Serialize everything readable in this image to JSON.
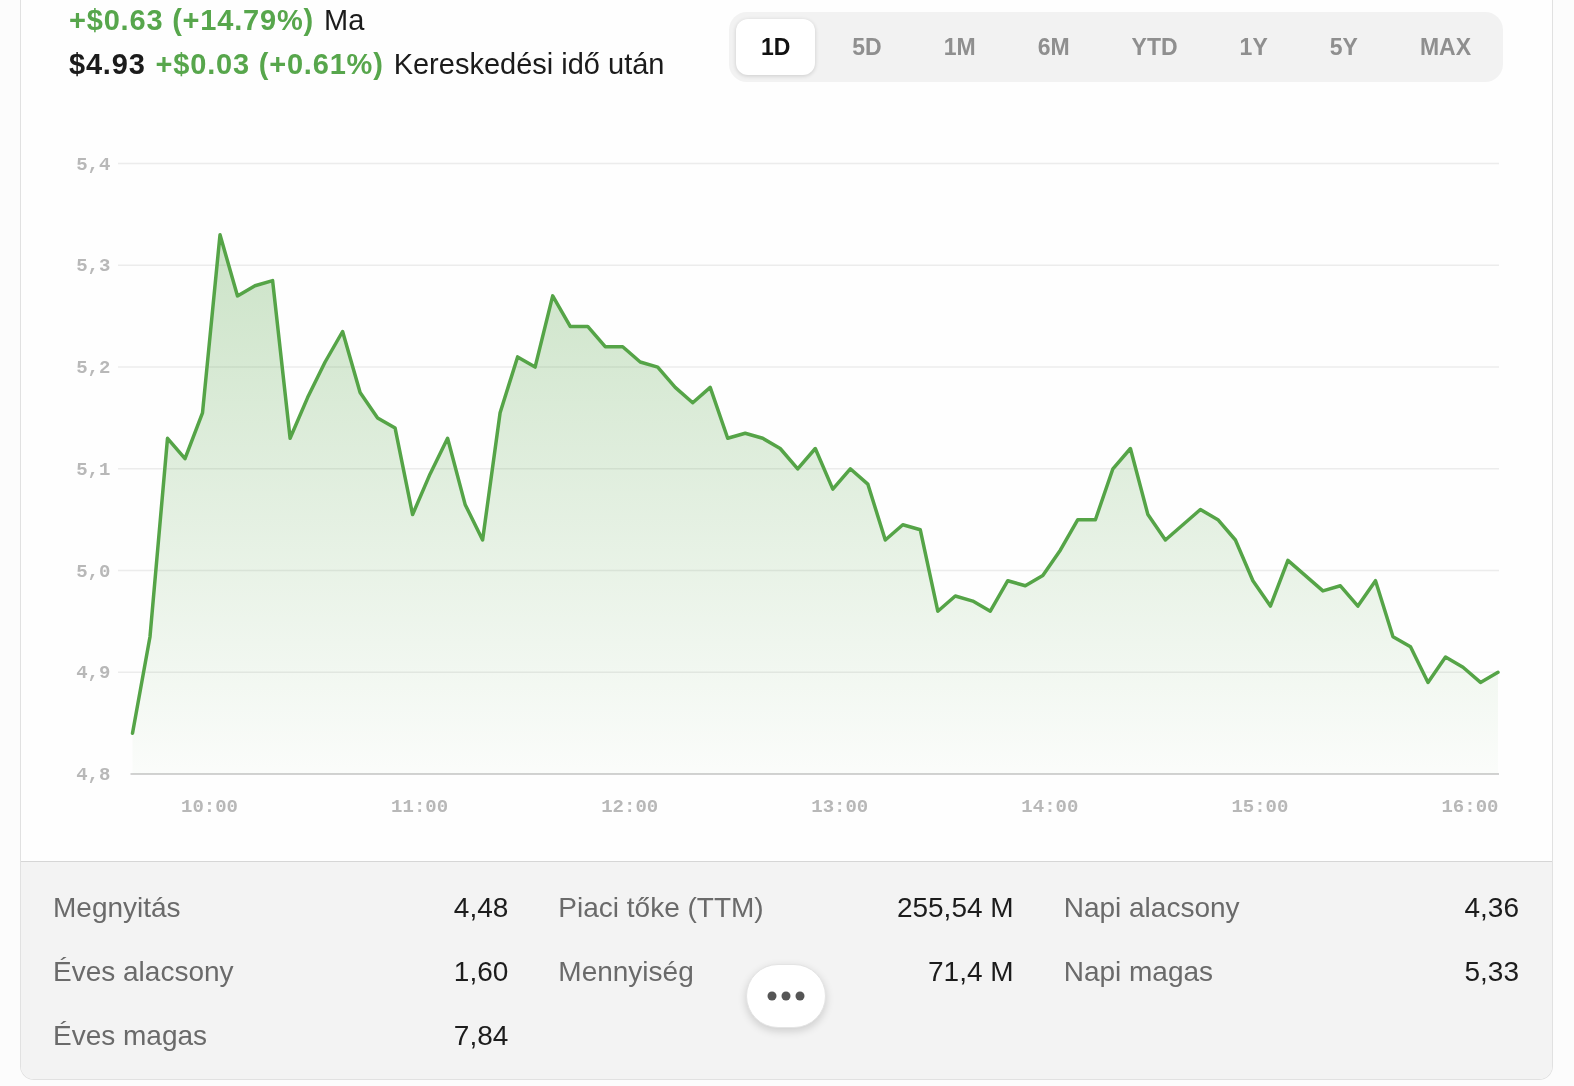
{
  "quote": {
    "today": {
      "change": "+$0.63 (+14.79%)",
      "label": "Ma"
    },
    "after_hours": {
      "price": "$4.93",
      "change": "+$0.03 (+0.61%)",
      "label": "Kereskedési idő után"
    }
  },
  "range_tabs": [
    {
      "label": "1D",
      "selected": true
    },
    {
      "label": "5D",
      "selected": false
    },
    {
      "label": "1M",
      "selected": false
    },
    {
      "label": "6M",
      "selected": false
    },
    {
      "label": "YTD",
      "selected": false
    },
    {
      "label": "1Y",
      "selected": false
    },
    {
      "label": "5Y",
      "selected": false
    },
    {
      "label": "MAX",
      "selected": false
    }
  ],
  "chart": {
    "chart_data": {
      "type": "area",
      "grid": true,
      "x": [
        578,
        583,
        588,
        593,
        598,
        603,
        608,
        613,
        618,
        623,
        628,
        633,
        638,
        643,
        648,
        653,
        658,
        663,
        668,
        673,
        678,
        683,
        688,
        693,
        698,
        703,
        708,
        713,
        718,
        723,
        728,
        733,
        738,
        743,
        748,
        753,
        758,
        763,
        768,
        773,
        778,
        783,
        788,
        793,
        798,
        803,
        808,
        813,
        818,
        823,
        828,
        833,
        838,
        843,
        848,
        853,
        858,
        863,
        868,
        873,
        878,
        883,
        888,
        893,
        898,
        903,
        908,
        913,
        918,
        923,
        928,
        933,
        938,
        943,
        948,
        953,
        958,
        963,
        968
      ],
      "series": [
        {
          "color": "#55a447",
          "values": [
            4.84,
            4.935,
            5.13,
            5.11,
            5.155,
            5.33,
            5.27,
            5.28,
            5.285,
            5.13,
            5.17,
            5.205,
            5.235,
            5.175,
            5.15,
            5.14,
            5.055,
            5.095,
            5.13,
            5.065,
            5.03,
            5.155,
            5.21,
            5.2,
            5.27,
            5.24,
            5.24,
            5.22,
            5.22,
            5.205,
            5.2,
            5.18,
            5.165,
            5.18,
            5.13,
            5.135,
            5.13,
            5.12,
            5.1,
            5.12,
            5.08,
            5.1,
            5.085,
            5.03,
            5.045,
            5.04,
            4.96,
            4.975,
            4.97,
            4.96,
            4.99,
            4.985,
            4.995,
            5.02,
            5.05,
            5.05,
            5.1,
            5.12,
            5.055,
            5.03,
            5.045,
            5.06,
            5.05,
            5.03,
            4.99,
            4.965,
            5.01,
            4.995,
            4.98,
            4.985,
            4.965,
            4.99,
            4.935,
            4.925,
            4.89,
            4.915,
            4.905,
            4.89,
            4.9
          ]
        }
      ],
      "xlim": [
        578,
        968
      ],
      "ylim": [
        4.8,
        5.4
      ],
      "xticks": [
        {
          "value": 600,
          "label": "10:00"
        },
        {
          "value": 660,
          "label": "11:00"
        },
        {
          "value": 720,
          "label": "12:00"
        },
        {
          "value": 780,
          "label": "13:00"
        },
        {
          "value": 840,
          "label": "14:00"
        },
        {
          "value": 900,
          "label": "15:00"
        },
        {
          "value": 960,
          "label": "16:00"
        }
      ],
      "yticks": [
        {
          "value": 5.4,
          "label": "5,4"
        },
        {
          "value": 5.3,
          "label": "5,3"
        },
        {
          "value": 5.2,
          "label": "5,2"
        },
        {
          "value": 5.1,
          "label": "5,1"
        },
        {
          "value": 5.0,
          "label": "5,0"
        },
        {
          "value": 4.9,
          "label": "4,9"
        },
        {
          "value": 4.8,
          "label": "4,8"
        }
      ]
    }
  },
  "stats": {
    "columns": [
      {
        "items": [
          {
            "label": "Megnyitás",
            "value": "4,48"
          },
          {
            "label": "Éves alacsony",
            "value": "1,60"
          },
          {
            "label": "Éves magas",
            "value": "7,84"
          }
        ]
      },
      {
        "items": [
          {
            "label": "Piaci tőke (TTM)",
            "value": "255,54 M"
          },
          {
            "label": "Mennyiség",
            "value": "71,4 M"
          }
        ]
      },
      {
        "items": [
          {
            "label": "Napi alacsony",
            "value": "4,36"
          },
          {
            "label": "Napi magas",
            "value": "5,33"
          }
        ]
      }
    ]
  }
}
